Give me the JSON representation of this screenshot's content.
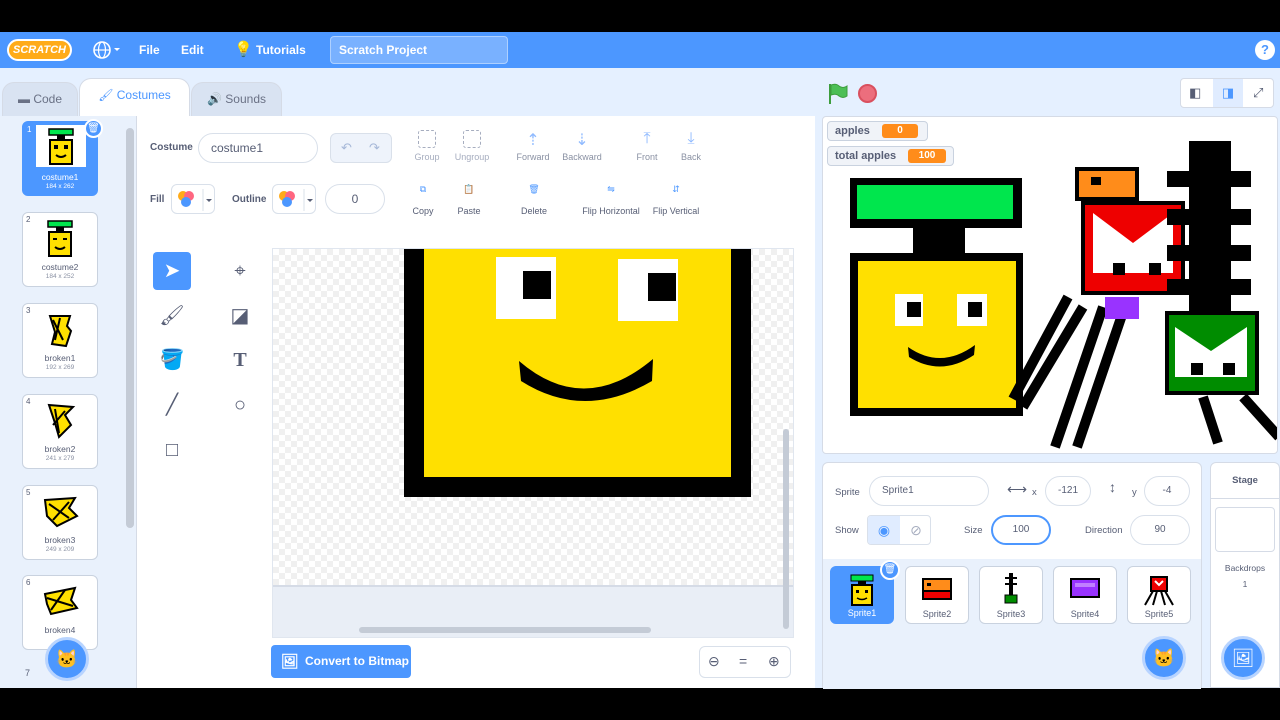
{
  "menu": {
    "logo": "SCRATCH",
    "file": "File",
    "edit": "Edit",
    "tutorials": "Tutorials",
    "project_title": "Scratch Project",
    "help": "?"
  },
  "tabs": {
    "code": "Code",
    "costumes": "Costumes",
    "sounds": "Sounds"
  },
  "costumes": [
    {
      "num": "1",
      "name": "costume1",
      "dims": "184 x 262"
    },
    {
      "num": "2",
      "name": "costume2",
      "dims": "184 x 252"
    },
    {
      "num": "3",
      "name": "broken1",
      "dims": "192 x 269"
    },
    {
      "num": "4",
      "name": "broken2",
      "dims": "241 x 279"
    },
    {
      "num": "5",
      "name": "broken3",
      "dims": "249 x 209"
    },
    {
      "num": "6",
      "name": "broken4",
      "dims": ""
    },
    {
      "num": "7",
      "name": "",
      "dims": ""
    }
  ],
  "editor": {
    "costume_label": "Costume",
    "costume_name": "costume1",
    "fill_label": "Fill",
    "outline_label": "Outline",
    "outline_width": "0",
    "group": "Group",
    "ungroup": "Ungroup",
    "forward": "Forward",
    "backward": "Backward",
    "front": "Front",
    "back": "Back",
    "copy": "Copy",
    "paste": "Paste",
    "delete": "Delete",
    "flip_h": "Flip Horizontal",
    "flip_v": "Flip Vertical",
    "convert": "Convert to Bitmap",
    "zoom_reset": "="
  },
  "variables": [
    {
      "name": "apples",
      "value": "0"
    },
    {
      "name": "total apples",
      "value": "100"
    }
  ],
  "sprite_info": {
    "sprite_label": "Sprite",
    "sprite_name": "Sprite1",
    "x_label": "x",
    "x": "-121",
    "y_label": "y",
    "y": "-4",
    "show_label": "Show",
    "size_label": "Size",
    "size": "100",
    "direction_label": "Direction",
    "direction": "90"
  },
  "sprites": [
    "Sprite1",
    "Sprite2",
    "Sprite3",
    "Sprite4",
    "Sprite5"
  ],
  "stage_panel": {
    "title": "Stage",
    "backdrops_label": "Backdrops",
    "backdrops_count": "1"
  },
  "colors": {
    "accent": "#4c97ff",
    "menubar": "#4c97ff",
    "variable": "#ff8c1a",
    "face": "#ffe000",
    "hat_green": "#00e64d"
  }
}
